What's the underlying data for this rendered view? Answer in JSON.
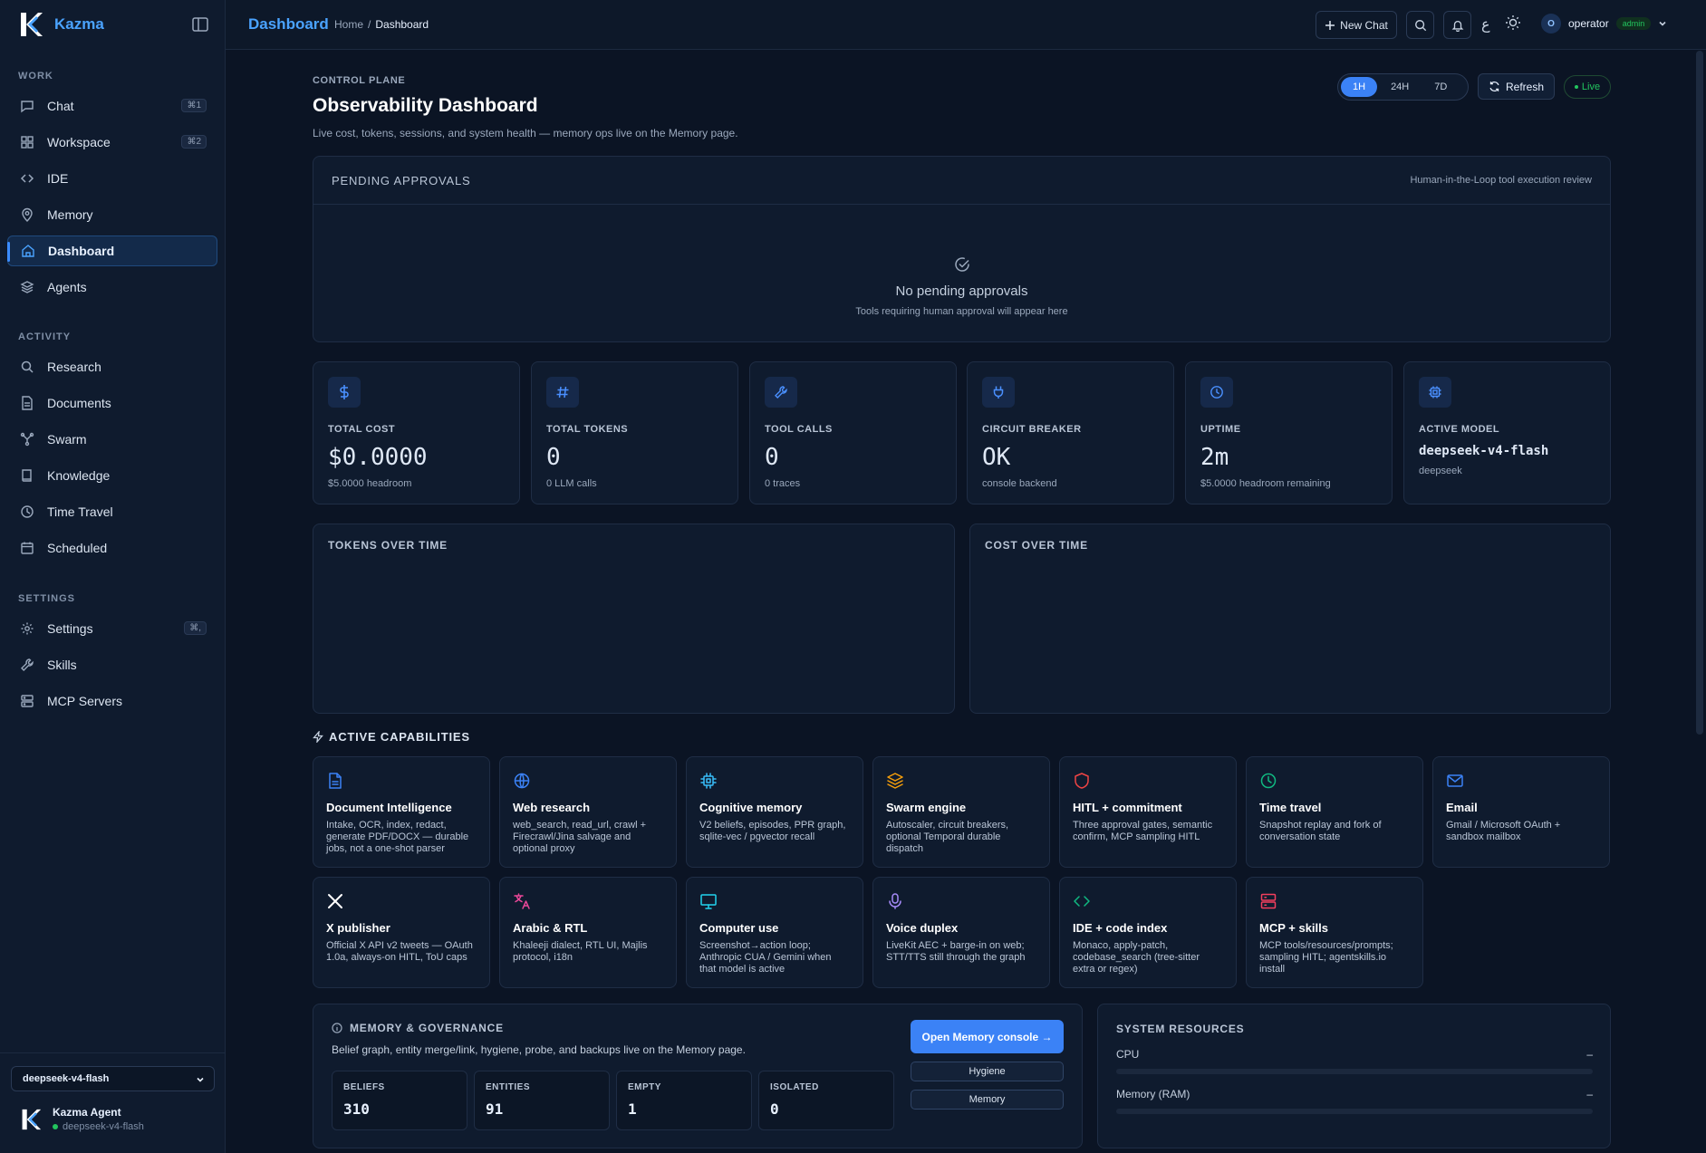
{
  "brand": {
    "name": "Kazma"
  },
  "sidebar": {
    "sections": {
      "work": "WORK",
      "activity": "ACTIVITY",
      "settings": "SETTINGS"
    },
    "items": [
      {
        "label": "Chat",
        "icon": "chat-icon",
        "shortcut": "⌘1"
      },
      {
        "label": "Workspace",
        "icon": "grid-icon",
        "shortcut": "⌘2"
      },
      {
        "label": "IDE",
        "icon": "code-icon"
      },
      {
        "label": "Memory",
        "icon": "pin-icon"
      },
      {
        "label": "Dashboard",
        "icon": "home-icon",
        "active": true
      },
      {
        "label": "Agents",
        "icon": "layers-icon"
      },
      {
        "label": "Research",
        "icon": "search-icon"
      },
      {
        "label": "Documents",
        "icon": "document-icon"
      },
      {
        "label": "Swarm",
        "icon": "network-icon"
      },
      {
        "label": "Knowledge",
        "icon": "book-icon"
      },
      {
        "label": "Time Travel",
        "icon": "clock-icon"
      },
      {
        "label": "Scheduled",
        "icon": "calendar-icon"
      },
      {
        "label": "Settings",
        "icon": "gear-icon",
        "shortcut": "⌘,"
      },
      {
        "label": "Skills",
        "icon": "wrench-icon"
      },
      {
        "label": "MCP Servers",
        "icon": "server-icon"
      }
    ],
    "model_select": "deepseek-v4-flash",
    "agent": {
      "name": "Kazma Agent",
      "model": "deepseek-v4-flash"
    }
  },
  "topbar": {
    "title": "Dashboard",
    "breadcrumb": {
      "home": "Home",
      "sep": "/",
      "current": "Dashboard"
    },
    "new_chat": "New Chat",
    "lang": "ع",
    "user": {
      "initial": "O",
      "name": "operator",
      "role": "admin"
    }
  },
  "header": {
    "eyebrow": "CONTROL PLANE",
    "title": "Observability Dashboard",
    "subtitle": "Live cost, tokens, sessions, and system health — memory ops live on the Memory page.",
    "ranges": [
      "1H",
      "24H",
      "7D"
    ],
    "active_range": "1H",
    "refresh": "Refresh",
    "live": "Live"
  },
  "approvals": {
    "title": "PENDING APPROVALS",
    "hint": "Human-in-the-Loop tool execution review",
    "empty_title": "No pending approvals",
    "empty_sub": "Tools requiring human approval will appear here"
  },
  "stats": [
    {
      "icon": "dollar-icon",
      "label": "TOTAL COST",
      "value": "$0.0000",
      "sub": "$5.0000 headroom"
    },
    {
      "icon": "hash-icon",
      "label": "TOTAL TOKENS",
      "value": "0",
      "sub": "0 LLM calls"
    },
    {
      "icon": "wrench-icon",
      "label": "TOOL CALLS",
      "value": "0",
      "sub": "0 traces"
    },
    {
      "icon": "plug-icon",
      "label": "CIRCUIT BREAKER",
      "value": "OK",
      "sub": "console backend"
    },
    {
      "icon": "clock-icon",
      "label": "UPTIME",
      "value": "2m",
      "sub": "$5.0000 headroom remaining"
    },
    {
      "icon": "cpu-icon",
      "label": "ACTIVE MODEL",
      "value": "deepseek-v4-flash",
      "sub": "deepseek"
    }
  ],
  "charts": {
    "tokens_title": "TOKENS OVER TIME",
    "cost_title": "COST OVER TIME"
  },
  "capabilities": {
    "title": "ACTIVE CAPABILITIES",
    "items": [
      {
        "icon": "document-icon",
        "color": "#3b82f6",
        "title": "Document Intelligence",
        "desc": "Intake, OCR, index, redact, generate PDF/DOCX — durable jobs, not a one-shot parser"
      },
      {
        "icon": "globe-icon",
        "color": "#3b82f6",
        "title": "Web research",
        "desc": "web_search, read_url, crawl + Firecrawl/Jina salvage and optional proxy"
      },
      {
        "icon": "cpu-icon",
        "color": "#38bdf8",
        "title": "Cognitive memory",
        "desc": "V2 beliefs, episodes, PPR graph, sqlite-vec / pgvector recall"
      },
      {
        "icon": "layers-icon",
        "color": "#f59e0b",
        "title": "Swarm engine",
        "desc": "Autoscaler, circuit breakers, optional Temporal durable dispatch"
      },
      {
        "icon": "shield-icon",
        "color": "#ef4444",
        "title": "HITL + commitment",
        "desc": "Three approval gates, semantic confirm, MCP sampling HITL"
      },
      {
        "icon": "clock-icon",
        "color": "#10b981",
        "title": "Time travel",
        "desc": "Snapshot replay and fork of conversation state"
      },
      {
        "icon": "mail-icon",
        "color": "#3b82f6",
        "title": "Email",
        "desc": "Gmail / Microsoft OAuth + sandbox mailbox"
      },
      {
        "icon": "x-logo-icon",
        "color": "#ffffff",
        "title": "X publisher",
        "desc": "Official X API v2 tweets — OAuth 1.0a, always-on HITL, ToU caps"
      },
      {
        "icon": "translate-icon",
        "color": "#ec4899",
        "title": "Arabic & RTL",
        "desc": "Khaleeji dialect, RTL UI, Majlis protocol, i18n"
      },
      {
        "icon": "monitor-icon",
        "color": "#22d3ee",
        "title": "Computer use",
        "desc": "Screenshot→action loop; Anthropic CUA / Gemini when that model is active"
      },
      {
        "icon": "mic-icon",
        "color": "#a78bfa",
        "title": "Voice duplex",
        "desc": "LiveKit AEC + barge-in on web; STT/TTS still through the graph"
      },
      {
        "icon": "code-icon",
        "color": "#10b981",
        "title": "IDE + code index",
        "desc": "Monaco, apply-patch, codebase_search (tree-sitter extra or regex)"
      },
      {
        "icon": "server-icon",
        "color": "#f43f5e",
        "title": "MCP + skills",
        "desc": "MCP tools/resources/prompts; sampling HITL; agentskills.io install"
      }
    ]
  },
  "governance": {
    "title": "MEMORY & GOVERNANCE",
    "desc": "Belief graph, entity merge/link, hygiene, probe, and backups live on the Memory page.",
    "stats": [
      {
        "label": "BELIEFS",
        "value": "310"
      },
      {
        "label": "ENTITIES",
        "value": "91"
      },
      {
        "label": "EMPTY",
        "value": "1"
      },
      {
        "label": "ISOLATED",
        "value": "0"
      }
    ],
    "primary": "Open Memory console →",
    "hygiene": "Hygiene",
    "memory": "Memory"
  },
  "system": {
    "title": "SYSTEM RESOURCES",
    "cpu_label": "CPU",
    "cpu_value": "–",
    "ram_label": "Memory (RAM)",
    "ram_value": "–"
  },
  "colors": {
    "accent": "#3b82f6",
    "brand": "#4aa3ff",
    "live": "#22c55e"
  }
}
